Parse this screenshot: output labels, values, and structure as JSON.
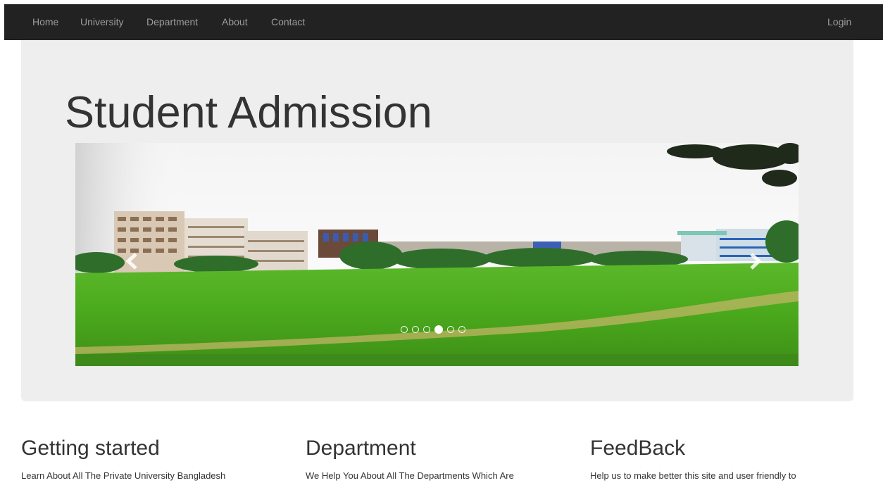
{
  "navbar": {
    "items": [
      {
        "label": "Home"
      },
      {
        "label": "University"
      },
      {
        "label": "Department"
      },
      {
        "label": "About"
      },
      {
        "label": "Contact"
      }
    ],
    "login_label": "Login",
    "background": "#222222",
    "link_color": "#9d9d9d"
  },
  "jumbotron": {
    "title": "Student Admission",
    "background": "#eeeeee"
  },
  "carousel": {
    "slide_count": 6,
    "active_index": 3,
    "prev_icon": "chevron-left-icon",
    "next_icon": "chevron-right-icon"
  },
  "columns": [
    {
      "heading": "Getting started",
      "text": "Learn About All The Private University Bangladesh"
    },
    {
      "heading": "Department",
      "text": "We Help You About All The Departments Which Are"
    },
    {
      "heading": "FeedBack",
      "text": "Help us to make better this site and user friendly to"
    }
  ]
}
